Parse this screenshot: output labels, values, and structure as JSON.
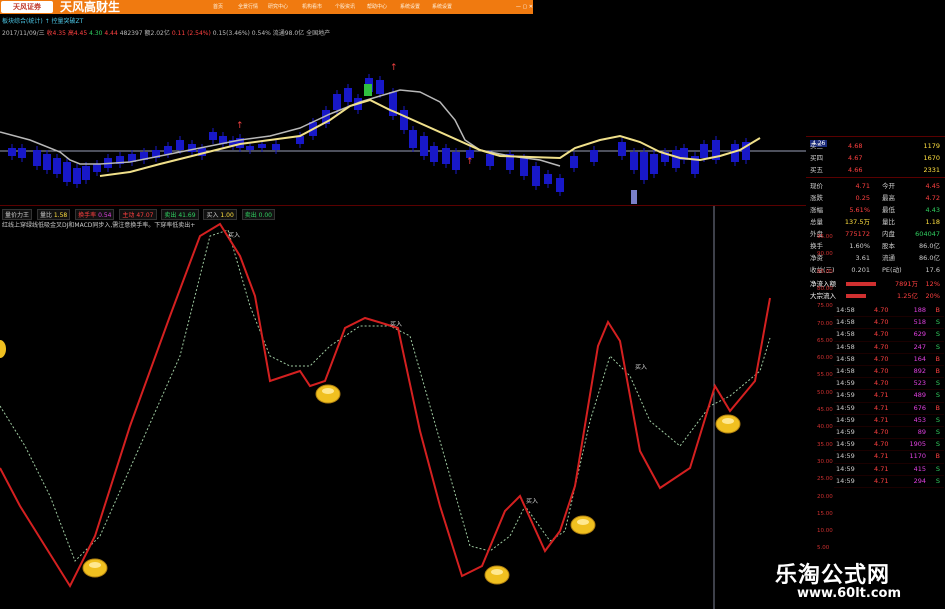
{
  "topbar": {
    "logo_text": "天风证券",
    "brand": "天风高财生",
    "menu": [
      "首页",
      "全景行情",
      "研究中心",
      "机构看市",
      "个股资讯",
      "帮助中心",
      "系统设置",
      "系统设置"
    ],
    "window_controls": "— ▢ ✕"
  },
  "stock_line": "板块综合(统计)  ↑ 控量突破ZT",
  "quote": {
    "date": "2017/11/09/三",
    "open": "收4.35",
    "high": "高4.45",
    "low": "4.30",
    "close": "4.44",
    "volume": "482397",
    "amount": "额2.02亿",
    "change": "0.11",
    "change_pct": "(2.54%)",
    "amplitude": "0.15(3.46%)",
    "turnover": "0.54%",
    "circulation": "流通98.0亿",
    "sector": "全国地产"
  },
  "indicator": {
    "name": "量价力王",
    "volume_ratio_label": "量比",
    "volume_ratio": "1.58",
    "turnover_label": "换手率",
    "turnover": "0.54",
    "main_label": "主动",
    "main": "47.07",
    "sell_label": "卖出",
    "sell": "41.69",
    "buy_label": "买入",
    "buy": "1.00",
    "sellout_label": "卖出",
    "sellout": "0.00",
    "desc": "红线上穿绿线低吸金叉DJ和MACD同步入,需注意换手率。下穿率低卖出+"
  },
  "chart_labels": {
    "signal_up": "↑",
    "marker_buy": "买入"
  },
  "order_book": [
    {
      "label": "买三",
      "price": "4.68",
      "vol": "1179"
    },
    {
      "label": "买四",
      "price": "4.67",
      "vol": "1670"
    },
    {
      "label": "买五",
      "price": "4.66",
      "vol": "2331"
    }
  ],
  "stats": [
    {
      "l1": "现价",
      "v1": "4.71",
      "l2": "今开",
      "v2": "4.45"
    },
    {
      "l1": "涨跌",
      "v1": "0.25",
      "l2": "最高",
      "v2": "4.72"
    },
    {
      "l1": "涨幅",
      "v1": "5.61%",
      "l2": "最低",
      "v2": "4.43"
    },
    {
      "l1": "总量",
      "v1": "137.5万",
      "l2": "量比",
      "v2": "1.18"
    },
    {
      "l1": "外盘",
      "v1": "775172",
      "l2": "内盘",
      "v2": "604047"
    },
    {
      "l1": "换手",
      "v1": "1.60%",
      "l2": "股本",
      "v2": "86.0亿"
    },
    {
      "l1": "净资",
      "v1": "3.61",
      "l2": "流通",
      "v2": "86.0亿"
    },
    {
      "l1": "收益(三)",
      "v1": "0.201",
      "l2": "PE(动)",
      "v2": "17.6"
    }
  ],
  "flows": [
    {
      "label": "净流入额",
      "value": "7891万",
      "pct": "12%"
    },
    {
      "label": "大宗流入",
      "value": "1.25亿",
      "pct": "20%"
    }
  ],
  "trades": [
    {
      "t": "14:58",
      "p": "4.70",
      "v": "188",
      "s": "B"
    },
    {
      "t": "14:58",
      "p": "4.70",
      "v": "518",
      "s": "S"
    },
    {
      "t": "14:58",
      "p": "4.70",
      "v": "629",
      "s": "S"
    },
    {
      "t": "14:58",
      "p": "4.70",
      "v": "247",
      "s": "S"
    },
    {
      "t": "14:58",
      "p": "4.70",
      "v": "164",
      "s": "B"
    },
    {
      "t": "14:58",
      "p": "4.70",
      "v": "892",
      "s": "B"
    },
    {
      "t": "14:59",
      "p": "4.70",
      "v": "523",
      "s": "S"
    },
    {
      "t": "14:59",
      "p": "4.71",
      "v": "489",
      "s": "S"
    },
    {
      "t": "14:59",
      "p": "4.71",
      "v": "676",
      "s": "B"
    },
    {
      "t": "14:59",
      "p": "4.71",
      "v": "453",
      "s": "S"
    },
    {
      "t": "14:59",
      "p": "4.70",
      "v": "89",
      "s": "S"
    },
    {
      "t": "14:59",
      "p": "4.70",
      "v": "1905",
      "s": "S"
    },
    {
      "t": "14:59",
      "p": "4.71",
      "v": "1170",
      "s": "B"
    },
    {
      "t": "14:59",
      "p": "4.71",
      "v": "415",
      "s": "S"
    },
    {
      "t": "14:59",
      "p": "4.71",
      "v": "294",
      "s": "S"
    }
  ],
  "axis_labels": [
    "95.00",
    "90.00",
    "85.00",
    "80.00",
    "75.00",
    "70.00",
    "65.00",
    "60.00",
    "55.00",
    "50.00",
    "45.00",
    "40.00",
    "35.00",
    "30.00",
    "25.00",
    "20.00",
    "15.00",
    "10.00",
    "5.00"
  ],
  "price_tag": "4.26",
  "watermark": {
    "title": "乐淘公式网",
    "url": "www.60lt.com"
  }
}
